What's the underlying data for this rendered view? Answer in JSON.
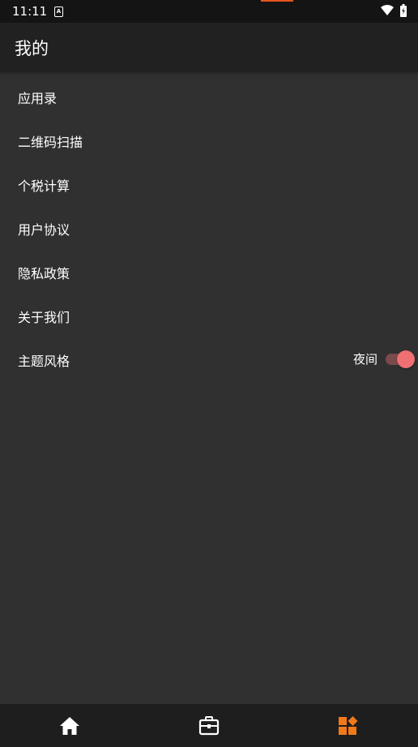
{
  "status_bar": {
    "time": "11:11",
    "notification_icon": "a-box-icon",
    "indicator_color": "#e8541f"
  },
  "app_bar": {
    "title": "我的"
  },
  "menu": {
    "items": [
      {
        "label": "应用录"
      },
      {
        "label": "二维码扫描"
      },
      {
        "label": "个税计算"
      },
      {
        "label": "用户协议"
      },
      {
        "label": "隐私政策"
      },
      {
        "label": "关于我们"
      },
      {
        "label": "主题风格",
        "value": "夜间",
        "toggle_on": true
      }
    ]
  },
  "bottom_nav": {
    "items": [
      {
        "icon": "home-icon",
        "active": false
      },
      {
        "icon": "briefcase-icon",
        "active": false
      },
      {
        "icon": "apps-icon",
        "active": true
      }
    ],
    "active_color": "#f07a1a",
    "inactive_color": "#ffffff"
  },
  "colors": {
    "background": "#303030",
    "app_bar": "#212121",
    "toggle_thumb": "#ef6f73",
    "toggle_track": "#7a4a4c"
  }
}
